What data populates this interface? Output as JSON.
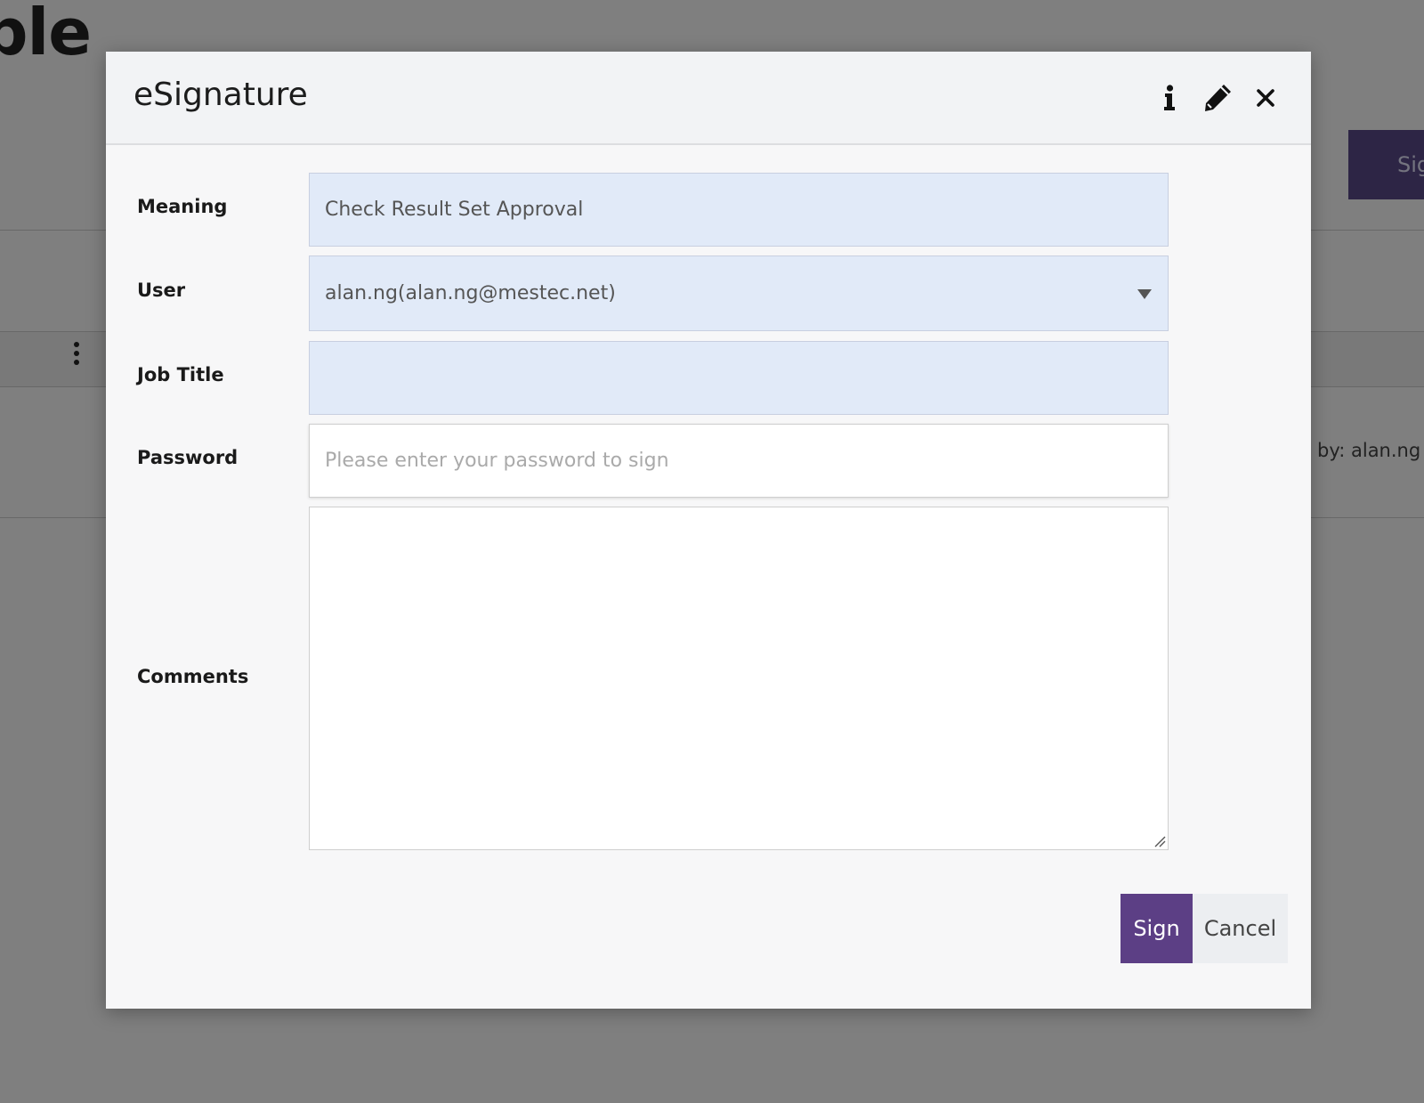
{
  "background": {
    "title_fragment": "ble",
    "sign_button_fragment": "Sig",
    "approved_fragment": "d by: alan.ng"
  },
  "dialog": {
    "title": "eSignature",
    "header_icons": [
      "info-icon",
      "pencil-icon",
      "close-icon"
    ]
  },
  "form": {
    "meaning": {
      "label": "Meaning",
      "value": "Check Result Set Approval"
    },
    "user": {
      "label": "User",
      "value": "alan.ng(alan.ng@mestec.net)"
    },
    "job_title": {
      "label": "Job Title",
      "value": ""
    },
    "password": {
      "label": "Password",
      "value": "",
      "placeholder": "Please enter your password to sign"
    },
    "comments": {
      "label": "Comments",
      "value": ""
    }
  },
  "actions": {
    "sign_label": "Sign",
    "cancel_label": "Cancel"
  },
  "colors": {
    "primary": "#5c3f85",
    "field_readonly_bg": "#e1eaf8",
    "overlay": "rgba(0,0,0,0.5)"
  }
}
